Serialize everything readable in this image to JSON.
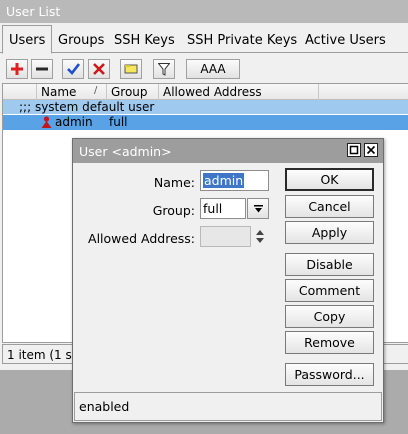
{
  "user_list": {
    "title": "User List",
    "tabs": [
      {
        "label": "Users"
      },
      {
        "label": "Groups"
      },
      {
        "label": "SSH Keys"
      },
      {
        "label": "SSH Private Keys"
      },
      {
        "label": "Active Users"
      }
    ],
    "toolbar": {
      "aaa_label": "AAA"
    },
    "columns": [
      "Name",
      "Group",
      "Allowed Address"
    ],
    "sort_indicator": "/",
    "group_row": ";;; system default user",
    "rows": [
      {
        "name": "admin",
        "group": "full",
        "allowed_address": ""
      }
    ],
    "status": "1 item (1 se"
  },
  "dialog": {
    "title": "User <admin>",
    "fields": {
      "name_label": "Name:",
      "name_value": "admin",
      "group_label": "Group:",
      "group_value": "full",
      "allowed_address_label": "Allowed Address:",
      "allowed_address_value": ""
    },
    "buttons": {
      "ok": "OK",
      "cancel": "Cancel",
      "apply": "Apply",
      "disable": "Disable",
      "comment": "Comment",
      "copy": "Copy",
      "remove": "Remove",
      "password": "Password..."
    },
    "status": "enabled"
  },
  "colors": {
    "selected_row": "#5aa2e6",
    "group_row": "#9fc9ef",
    "add_icon": "#e02020",
    "apply_icon": "#1f4fcf"
  },
  "icons": [
    "plus-icon",
    "minus-icon",
    "check-icon",
    "cross-icon",
    "comment-note-icon",
    "filter-icon",
    "user-icon",
    "maximize-icon",
    "close-icon",
    "dropdown-arrow-icon",
    "spinner-arrows-icon"
  ]
}
